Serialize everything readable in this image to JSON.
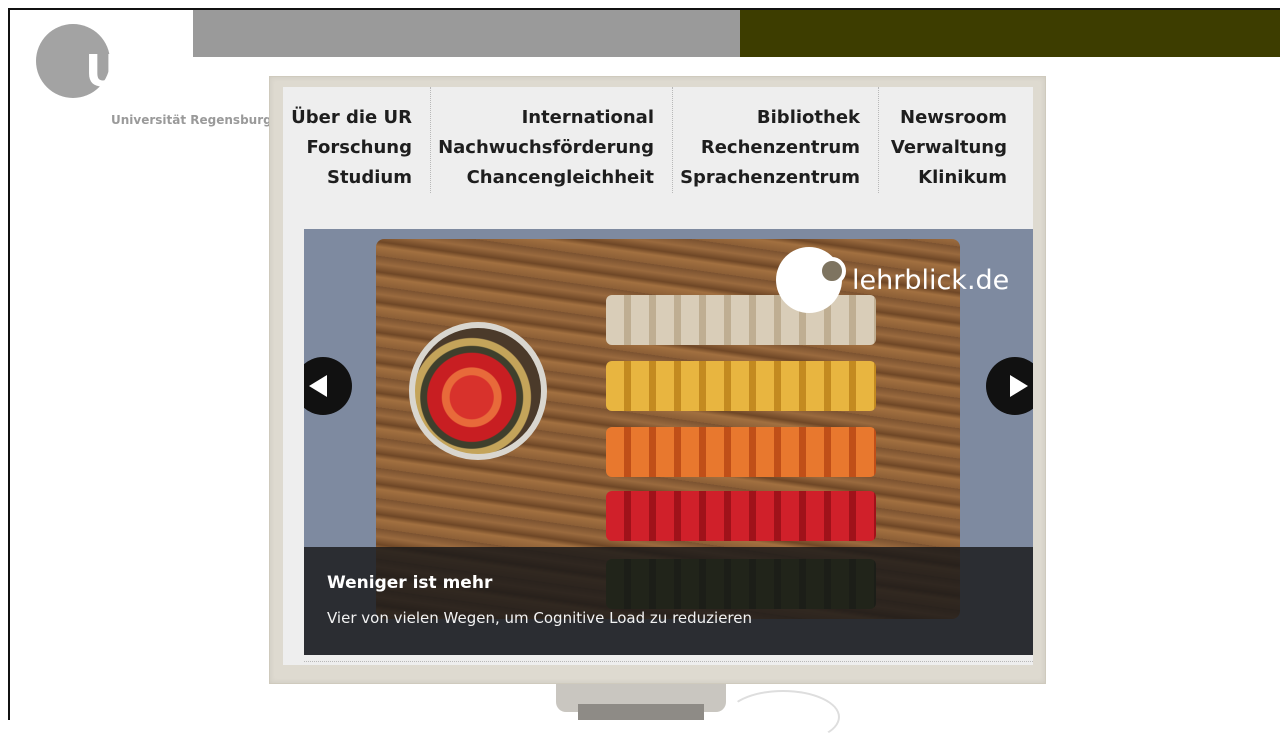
{
  "logo": {
    "mark": "UR",
    "name": "Universität Regensburg"
  },
  "menu": {
    "columns": [
      [
        "Über die UR",
        "Forschung",
        "Studium"
      ],
      [
        "International",
        "Nachwuchsförderung",
        "Chancengleichheit"
      ],
      [
        "Bibliothek",
        "Rechenzentrum",
        "Sprachenzentrum"
      ],
      [
        "Newsroom",
        "Verwaltung",
        "Klinikum"
      ]
    ]
  },
  "slider": {
    "brand": "lehrblick.de",
    "title": "Weniger ist mehr",
    "subtitle": "Vier von vielen Wegen, um Cognitive Load zu reduzieren",
    "prev_icon": "arrow-left-icon",
    "next_icon": "arrow-right-icon"
  },
  "colors": {
    "top_bar_gray": "#9a9a9a",
    "top_bar_olive": "#3d3d00",
    "logo_gray": "#a3a3a3",
    "caption_bg": "#18181a"
  }
}
